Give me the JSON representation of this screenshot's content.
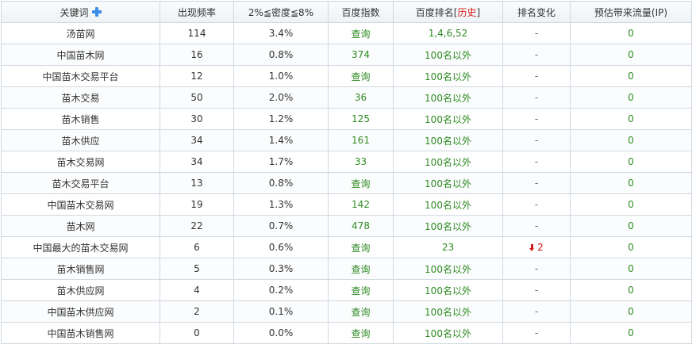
{
  "headers": {
    "keyword": "关键词",
    "frequency": "出现频率",
    "density": "2%≦密度≦8%",
    "baidu_index": "百度指数",
    "baidu_rank_prefix": "百度排名[",
    "baidu_rank_history": "历史",
    "baidu_rank_suffix": "]",
    "rank_change": "排名变化",
    "traffic": "预估带来流量(IP)"
  },
  "icons": {
    "add_keyword": "plus-icon",
    "rank_down": "down-arrow-icon"
  },
  "colors": {
    "green_text": "#2e8b22",
    "history_link": "#d91c1c",
    "rank_down": "#d11a1a",
    "plus_icon": "#3a8ee6"
  },
  "rows": [
    {
      "keyword": "汤苗网",
      "frequency": "114",
      "density": "3.4%",
      "index": "查询",
      "rank": "1,4,6,52",
      "change": "-",
      "traffic": "0"
    },
    {
      "keyword": "中国苗木网",
      "frequency": "16",
      "density": "0.8%",
      "index": "374",
      "rank": "100名以外",
      "change": "-",
      "traffic": "0"
    },
    {
      "keyword": "中国苗木交易平台",
      "frequency": "12",
      "density": "1.0%",
      "index": "查询",
      "rank": "100名以外",
      "change": "-",
      "traffic": "0"
    },
    {
      "keyword": "苗木交易",
      "frequency": "50",
      "density": "2.0%",
      "index": "36",
      "rank": "100名以外",
      "change": "-",
      "traffic": "0"
    },
    {
      "keyword": "苗木销售",
      "frequency": "30",
      "density": "1.2%",
      "index": "125",
      "rank": "100名以外",
      "change": "-",
      "traffic": "0"
    },
    {
      "keyword": "苗木供应",
      "frequency": "34",
      "density": "1.4%",
      "index": "161",
      "rank": "100名以外",
      "change": "-",
      "traffic": "0"
    },
    {
      "keyword": "苗木交易网",
      "frequency": "34",
      "density": "1.7%",
      "index": "33",
      "rank": "100名以外",
      "change": "-",
      "traffic": "0"
    },
    {
      "keyword": "苗木交易平台",
      "frequency": "13",
      "density": "0.8%",
      "index": "查询",
      "rank": "100名以外",
      "change": "-",
      "traffic": "0"
    },
    {
      "keyword": "中国苗木交易网",
      "frequency": "19",
      "density": "1.3%",
      "index": "142",
      "rank": "100名以外",
      "change": "-",
      "traffic": "0"
    },
    {
      "keyword": "苗木网",
      "frequency": "22",
      "density": "0.7%",
      "index": "478",
      "rank": "100名以外",
      "change": "-",
      "traffic": "0"
    },
    {
      "keyword": "中国最大的苗木交易网",
      "frequency": "6",
      "density": "0.6%",
      "index": "查询",
      "rank": "23",
      "change": "2",
      "change_dir": "down",
      "traffic": "0"
    },
    {
      "keyword": "苗木销售网",
      "frequency": "5",
      "density": "0.3%",
      "index": "查询",
      "rank": "100名以外",
      "change": "-",
      "traffic": "0"
    },
    {
      "keyword": "苗木供应网",
      "frequency": "4",
      "density": "0.2%",
      "index": "查询",
      "rank": "100名以外",
      "change": "-",
      "traffic": "0"
    },
    {
      "keyword": "中国苗木供应网",
      "frequency": "2",
      "density": "0.1%",
      "index": "查询",
      "rank": "100名以外",
      "change": "-",
      "traffic": "0"
    },
    {
      "keyword": "中国苗木销售网",
      "frequency": "0",
      "density": "0.0%",
      "index": "查询",
      "rank": "100名以外",
      "change": "-",
      "traffic": "0"
    }
  ]
}
